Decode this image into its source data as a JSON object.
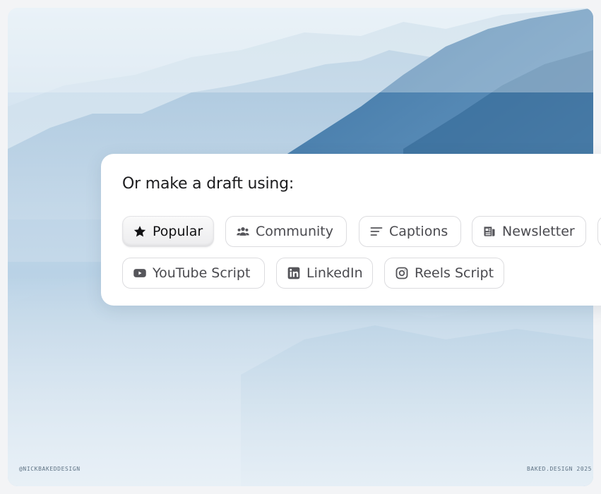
{
  "card": {
    "title": "Or make a draft using:",
    "chips": [
      {
        "label": "Popular",
        "icon": "star-icon",
        "selected": true
      },
      {
        "label": "Community",
        "icon": "users-icon",
        "selected": false
      },
      {
        "label": "Captions",
        "icon": "text-lines-icon",
        "selected": false
      },
      {
        "label": "Newsletter",
        "icon": "newspaper-icon",
        "selected": false
      },
      {
        "label": "YouTube Script",
        "icon": "youtube-icon",
        "selected": false
      },
      {
        "label": "LinkedIn",
        "icon": "linkedin-icon",
        "selected": false
      },
      {
        "label": "Reels Script",
        "icon": "instagram-icon",
        "selected": false
      }
    ]
  },
  "footer": {
    "left": "@NICKBAKEDDESIGN",
    "right": "BAKED.DESIGN 2025"
  },
  "colors": {
    "chip_border": "#dcdcdf",
    "chip_text": "#4a4a4f",
    "title_text": "#1c1c1e",
    "mountain_dark": "#2f6592"
  }
}
